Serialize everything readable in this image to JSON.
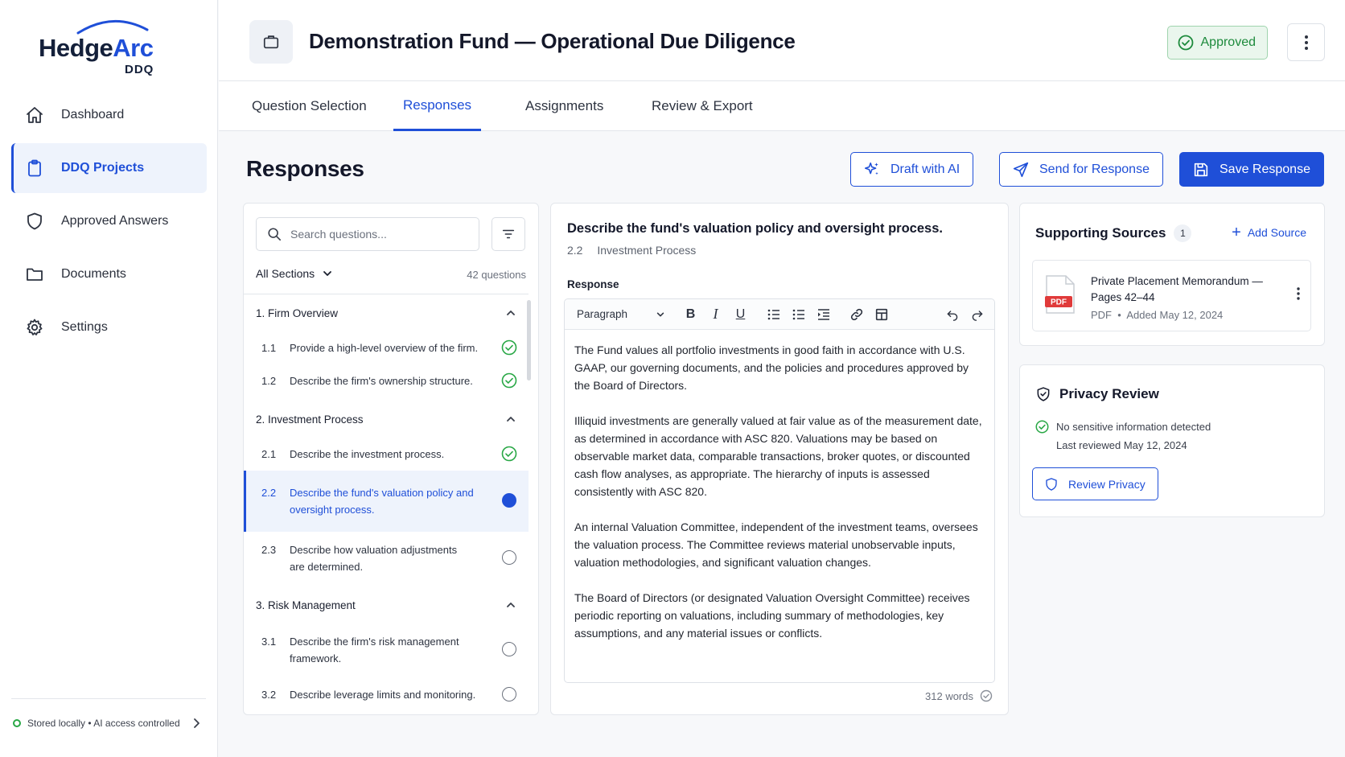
{
  "brand": {
    "name_part1": "Hedge",
    "name_part2": "Arc",
    "sub": "DDQ"
  },
  "sidebar": {
    "items": [
      {
        "label": "Dashboard",
        "icon": "home-icon"
      },
      {
        "label": "DDQ Projects",
        "icon": "clipboard-icon",
        "active": true
      },
      {
        "label": "Approved Answers",
        "icon": "shield-icon"
      },
      {
        "label": "Documents",
        "icon": "folder-icon"
      },
      {
        "label": "Settings",
        "icon": "gear-icon"
      }
    ],
    "footer": "Stored locally • AI access controlled"
  },
  "header": {
    "title": "Demonstration Fund — Operational Due Diligence",
    "status": "Approved"
  },
  "tabs": [
    {
      "label": "Question Selection"
    },
    {
      "label": "Responses",
      "active": true
    },
    {
      "label": "Assignments"
    },
    {
      "label": "Review & Export"
    }
  ],
  "main": {
    "title": "Responses",
    "actions": {
      "draft": "Draft with AI",
      "send": "Send for Response",
      "save": "Save Response"
    }
  },
  "questions": {
    "search_placeholder": "Search questions...",
    "section_filter": "All Sections",
    "count": "42 questions",
    "sections": [
      {
        "title": "1.  Firm Overview",
        "items": [
          {
            "num": "1.1",
            "text": "Provide a high-level overview of the firm.",
            "status": "done"
          },
          {
            "num": "1.2",
            "text": "Describe the firm's ownership structure.",
            "status": "done"
          }
        ]
      },
      {
        "title": "2.  Investment Process",
        "items": [
          {
            "num": "2.1",
            "text": "Describe the investment process.",
            "status": "done"
          },
          {
            "num": "2.2",
            "text": "Describe the fund's valuation policy and oversight process.",
            "status": "active"
          },
          {
            "num": "2.3",
            "text": "Describe how valuation adjustments are determined.",
            "status": "open"
          }
        ]
      },
      {
        "title": "3.  Risk Management",
        "items": [
          {
            "num": "3.1",
            "text": "Describe the firm's risk management framework.",
            "status": "open"
          },
          {
            "num": "3.2",
            "text": "Describe leverage limits and monitoring.",
            "status": "open"
          }
        ]
      }
    ]
  },
  "response": {
    "question": "Describe the fund's valuation policy and oversight process.",
    "number": "2.2",
    "section": "Investment Process",
    "label": "Response",
    "format": "Paragraph",
    "paragraphs": [
      "The Fund values all portfolio investments in good faith in accordance with U.S. GAAP, our governing documents, and the policies and procedures approved by the Board of Directors.",
      "Illiquid investments are generally valued at fair value as of the measurement date, as determined in accordance with ASC 820. Valuations may be based on observable market data, comparable transactions, broker quotes, or discounted cash flow analyses, as appropriate. The hierarchy of inputs is assessed consistently with ASC 820.",
      "An internal Valuation Committee, independent of the investment teams, oversees the valuation process. The Committee reviews material unobservable inputs, valuation methodologies, and significant valuation changes.",
      "The Board of Directors (or designated Valuation Oversight Committee) receives periodic reporting on valuations, including summary of methodologies, key assumptions, and any material issues or conflicts."
    ],
    "word_count": "312 words"
  },
  "sources": {
    "title": "Supporting Sources",
    "count": "1",
    "add_label": "Add Source",
    "items": [
      {
        "name": "Private Placement Memorandum — Pages 42–44",
        "type": "PDF",
        "added": "Added May 12, 2024"
      }
    ]
  },
  "privacy": {
    "title": "Privacy Review",
    "status": "No sensitive information detected",
    "last_reviewed": "Last reviewed May 12, 2024",
    "button": "Review Privacy"
  },
  "colors": {
    "accent": "#1f4fd8",
    "success": "#28a745",
    "text": "#14182a"
  }
}
